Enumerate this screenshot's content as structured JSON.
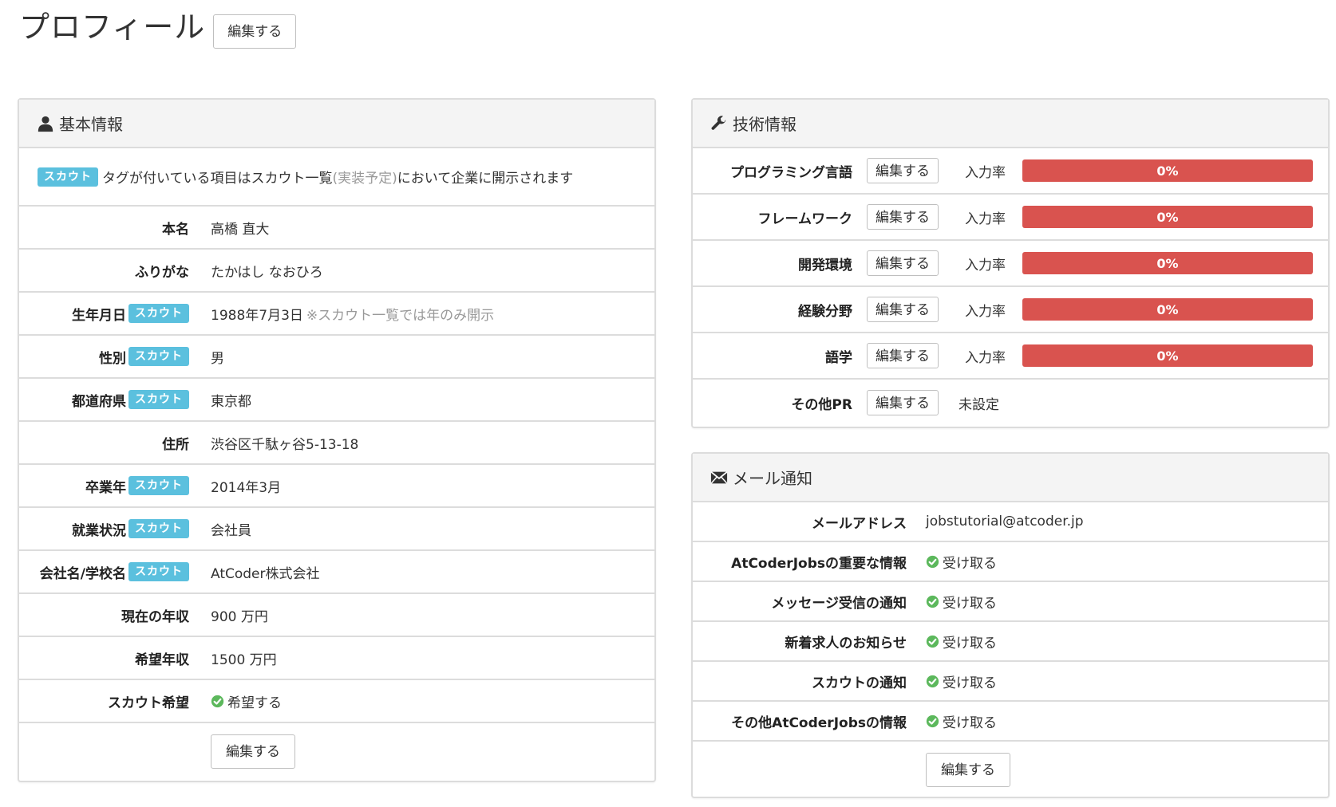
{
  "page": {
    "title": "プロフィール",
    "edit_label": "編集する"
  },
  "basic": {
    "heading": "基本情報",
    "icon": "user-icon",
    "notice": {
      "tag": "スカウト",
      "text_before": "タグが付いている項目はスカウト一覧",
      "text_muted": "(実装予定)",
      "text_after": "において企業に開示されます"
    },
    "rows": [
      {
        "label": "本名",
        "scout": false,
        "value": "高橋 直大"
      },
      {
        "label": "ふりがな",
        "scout": false,
        "value": "たかはし なおひろ"
      },
      {
        "label": "生年月日",
        "scout": true,
        "value": "1988年7月3日",
        "note": "※スカウト一覧では年のみ開示"
      },
      {
        "label": "性別",
        "scout": true,
        "value": "男"
      },
      {
        "label": "都道府県",
        "scout": true,
        "value": "東京都"
      },
      {
        "label": "住所",
        "scout": false,
        "value": "渋谷区千駄ヶ谷5-13-18"
      },
      {
        "label": "卒業年",
        "scout": true,
        "value": "2014年3月"
      },
      {
        "label": "就業状況",
        "scout": true,
        "value": "会社員"
      },
      {
        "label": "会社名/学校名",
        "scout": true,
        "value": "AtCoder株式会社"
      },
      {
        "label": "現在の年収",
        "scout": false,
        "value": "900 万円"
      },
      {
        "label": "希望年収",
        "scout": false,
        "value": "1500 万円"
      },
      {
        "label": "スカウト希望",
        "scout": false,
        "value": "希望する",
        "check": true
      }
    ],
    "scout_tag": "スカウト",
    "edit_label": "編集する"
  },
  "tech": {
    "heading": "技術情報",
    "icon": "wrench-icon",
    "rate_label": "入力率",
    "edit_label": "編集する",
    "bar_color": "#d9534f",
    "rows": [
      {
        "label": "プログラミング言語",
        "rate": "0%"
      },
      {
        "label": "フレームワーク",
        "rate": "0%"
      },
      {
        "label": "開発環境",
        "rate": "0%"
      },
      {
        "label": "経験分野",
        "rate": "0%"
      },
      {
        "label": "語学",
        "rate": "0%"
      }
    ],
    "other": {
      "label": "その他PR",
      "value": "未設定"
    }
  },
  "mail": {
    "heading": "メール通知",
    "icon": "envelope-icon",
    "address_label": "メールアドレス",
    "address_value": "jobstutorial@atcoder.jp",
    "rows": [
      {
        "label": "AtCoderJobsの重要な情報",
        "value": "受け取る"
      },
      {
        "label": "メッセージ受信の通知",
        "value": "受け取る"
      },
      {
        "label": "新着求人のお知らせ",
        "value": "受け取る"
      },
      {
        "label": "スカウトの通知",
        "value": "受け取る"
      },
      {
        "label": "その他AtCoderJobsの情報",
        "value": "受け取る"
      }
    ],
    "edit_label": "編集する"
  },
  "colors": {
    "scout_tag": "#5bc0de",
    "check": "#5cb85c",
    "progress_danger": "#d9534f"
  }
}
